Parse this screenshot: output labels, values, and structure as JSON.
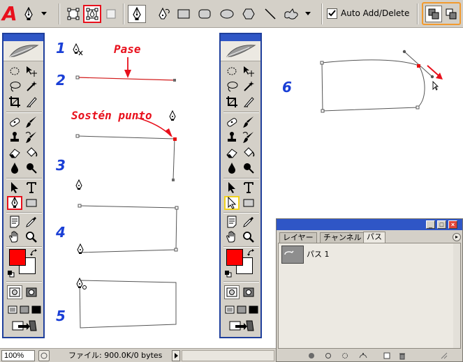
{
  "brand_letter": "A",
  "options_bar": {
    "tools": [
      "pen-icon",
      "chevron-down-icon",
      "shape-layers-icon",
      "paths-icon",
      "fill-pixels-icon",
      "pen-icon",
      "freeform-pen-icon",
      "rectangle-icon",
      "rounded-rectangle-icon",
      "ellipse-icon",
      "polygon-icon",
      "line-icon",
      "custom-shape-icon",
      "chevron-down-icon",
      "add-to-path-icon",
      "subtract-from-path-icon"
    ],
    "auto_add_delete_label": "Auto Add/Delete",
    "auto_add_delete_checked": true
  },
  "tools_palette": {
    "selected_left": "pen-tool",
    "selected_right": "direct-selection-tool",
    "foreground_color": "#ff0000",
    "background_color": "#ffffff"
  },
  "steps": {
    "s1": "1",
    "s2": "2",
    "s3": "3",
    "s4": "4",
    "s5": "5",
    "s6": "6"
  },
  "annotations": {
    "pase": "Pase",
    "sosten": "Sostén punto"
  },
  "status_bar": {
    "zoom": "100%",
    "file_info": "ファイル: 900.0K/0 bytes"
  },
  "paths_panel": {
    "tabs": [
      "レイヤー",
      "チャンネル",
      "パス"
    ],
    "active_tab": "パス",
    "items": [
      "パス 1"
    ]
  },
  "colors": {
    "accent_red": "#e8101c",
    "step_blue": "#1a3fd6",
    "palette_blue": "#2f56c6",
    "highlight_yellow": "#f1d21d",
    "highlight_orange": "#f29a2e"
  }
}
